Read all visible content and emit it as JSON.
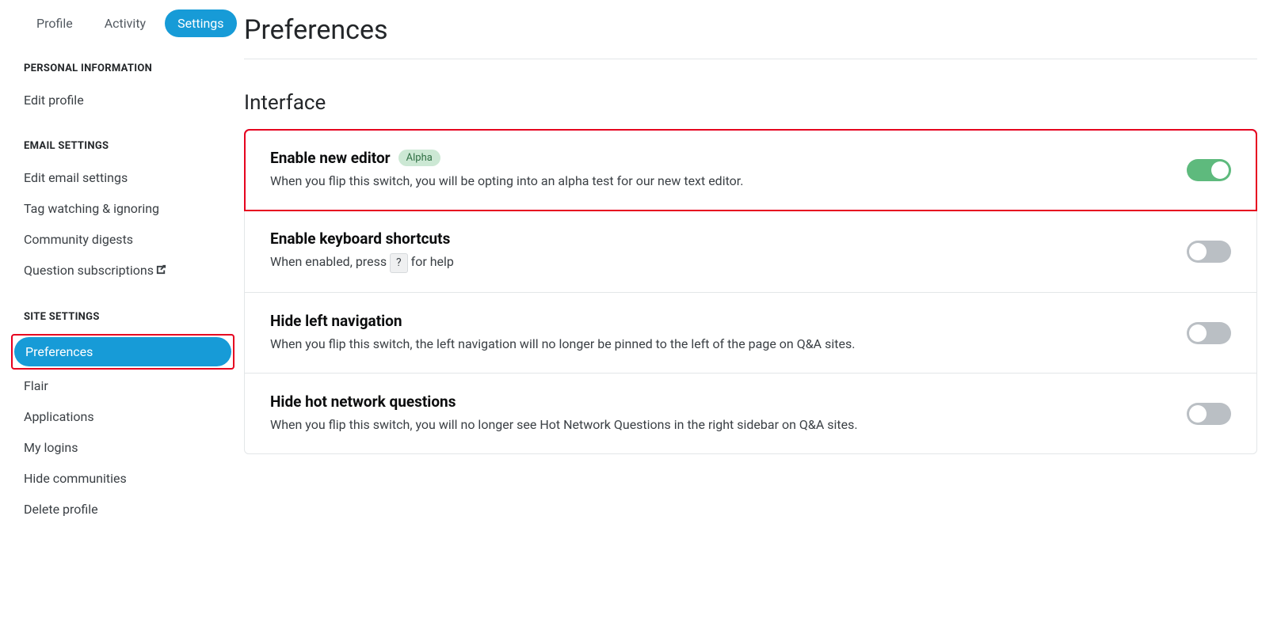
{
  "tabs": {
    "profile": "Profile",
    "activity": "Activity",
    "settings": "Settings"
  },
  "sidebar": {
    "personal": {
      "heading": "PERSONAL INFORMATION",
      "items": [
        "Edit profile"
      ]
    },
    "email": {
      "heading": "EMAIL SETTINGS",
      "items": [
        "Edit email settings",
        "Tag watching & ignoring",
        "Community digests",
        "Question subscriptions"
      ]
    },
    "site": {
      "heading": "SITE SETTINGS",
      "items": [
        "Preferences",
        "Flair",
        "Applications",
        "My logins",
        "Hide communities",
        "Delete profile"
      ]
    }
  },
  "page": {
    "title": "Preferences",
    "section_title": "Interface"
  },
  "settings": [
    {
      "title": "Enable new editor",
      "badge": "Alpha",
      "desc": "When you flip this switch, you will be opting into an alpha test for our new text editor.",
      "on": true,
      "highlighted": true
    },
    {
      "title": "Enable keyboard shortcuts",
      "desc_pre": "When enabled, press ",
      "kbd": "?",
      "desc_post": " for help",
      "on": false
    },
    {
      "title": "Hide left navigation",
      "desc": "When you flip this switch, the left navigation will no longer be pinned to the left of the page on Q&A sites.",
      "on": false
    },
    {
      "title": "Hide hot network questions",
      "desc": "When you flip this switch, you will no longer see Hot Network Questions in the right sidebar on Q&A sites.",
      "on": false
    }
  ]
}
